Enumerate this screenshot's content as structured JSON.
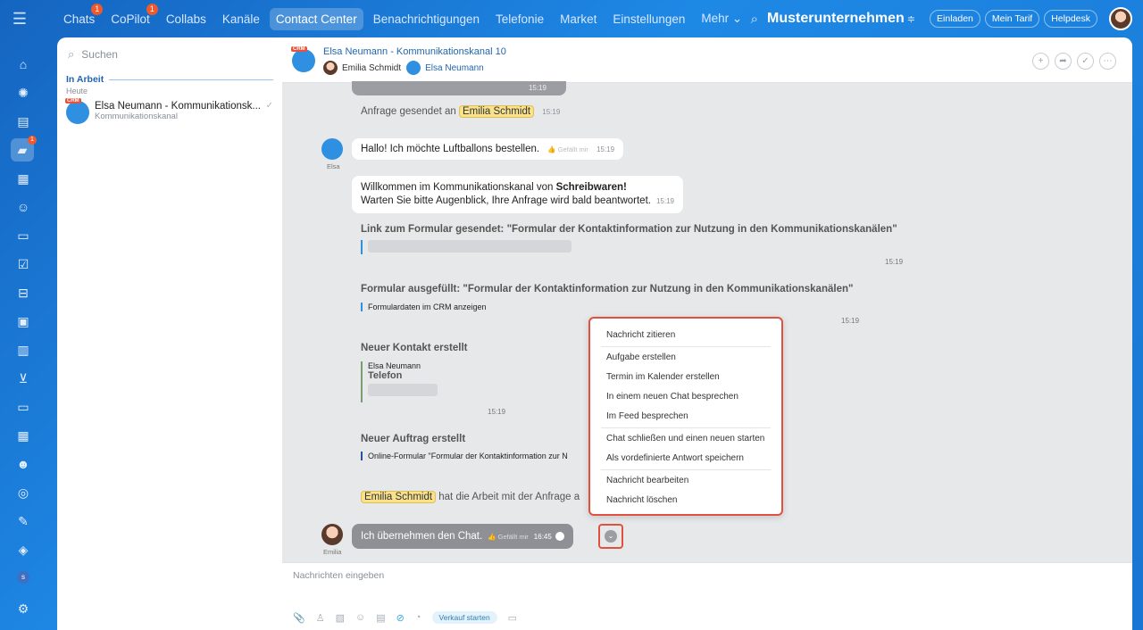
{
  "topbar": {
    "nav": [
      {
        "label": "Chats",
        "badge": "1"
      },
      {
        "label": "CoPilot",
        "badge": "1"
      },
      {
        "label": "Collabs",
        "badge": ""
      },
      {
        "label": "Kanäle",
        "badge": ""
      },
      {
        "label": "Contact Center",
        "badge": "",
        "active": true
      },
      {
        "label": "Benachrichtigungen",
        "badge": ""
      },
      {
        "label": "Telefonie",
        "badge": ""
      },
      {
        "label": "Market",
        "badge": ""
      },
      {
        "label": "Einstellungen",
        "badge": ""
      },
      {
        "label": "Mehr ⌄",
        "badge": ""
      }
    ],
    "company": "Musterunternehmen",
    "buttons": {
      "invite": "Einladen",
      "plan": "Mein Tarif",
      "helpdesk": "Helpdesk"
    }
  },
  "rail": {
    "chat_badge": "1",
    "user_initial": "s"
  },
  "sidebar": {
    "search_placeholder": "Suchen",
    "group_label": "In Arbeit",
    "sub_label": "Heute",
    "items": [
      {
        "crm": "CRM",
        "title": "Elsa Neumann - Kommunikationsk...",
        "subtitle": "Kommunikationskanal"
      }
    ]
  },
  "chat": {
    "crm": "CRM",
    "title": "Elsa Neumann - Kommunikationskanal 10",
    "members": [
      "Emilia Schmidt",
      "Elsa Neumann"
    ],
    "messages": {
      "top_time": "15:19",
      "request_sent_prefix": "Anfrage gesendet an",
      "request_sent_name": "Emilia Schmidt",
      "request_sent_time": "15:19",
      "elsa_name": "Elsa",
      "hello_text": "Hallo! Ich möchte Luftballons bestellen.",
      "like_label": "Gefällt mir",
      "hello_time": "15:19",
      "welcome_line1_prefix": "Willkommen im Kommunikationskanal von",
      "welcome_line1_bold": "Schreibwaren!",
      "welcome_line2": "Warten Sie bitte Augenblick, Ihre Anfrage wird bald beantwortet.",
      "welcome_time": "15:19",
      "link_title": "Link zum Formular gesendet: \"Formular der Kontaktinformation zur Nutzung in den Kommunikationskanälen\"",
      "link_time": "15:19",
      "filled_title": "Formular ausgefüllt: \"Formular der Kontaktinformation zur Nutzung in den Kommunikationskanälen\"",
      "filled_link": "Formulardaten im CRM anzeigen",
      "filled_time": "15:19",
      "contact_title": "Neuer Kontakt erstellt",
      "contact_name": "Elsa Neumann",
      "contact_field": "Telefon",
      "contact_time": "15:19",
      "order_title": "Neuer Auftrag erstellt",
      "order_text": "Online-Formular \"Formular der Kontaktinformation zur N",
      "took_name": "Emilia Schmidt",
      "took_text": "hat die Arbeit mit der Anfrage a",
      "emilia_name": "Emilia",
      "my_text": "Ich übernehmen den Chat.",
      "my_time": "16:45"
    },
    "context_menu": [
      "Nachricht zitieren",
      "Aufgabe erstellen",
      "Termin im Kalender erstellen",
      "In einem neuen Chat besprechen",
      "Im Feed besprechen",
      "Chat schließen und einen neuen starten",
      "Als vordefinierte Antwort speichern",
      "Nachricht bearbeiten",
      "Nachricht löschen"
    ],
    "composer": {
      "placeholder": "Nachrichten eingeben",
      "sale_button": "Verkauf starten"
    }
  },
  "colors": {
    "accent": "#2066b0",
    "highlight": "#e0523f",
    "name_highlight": "#f9e28d"
  }
}
